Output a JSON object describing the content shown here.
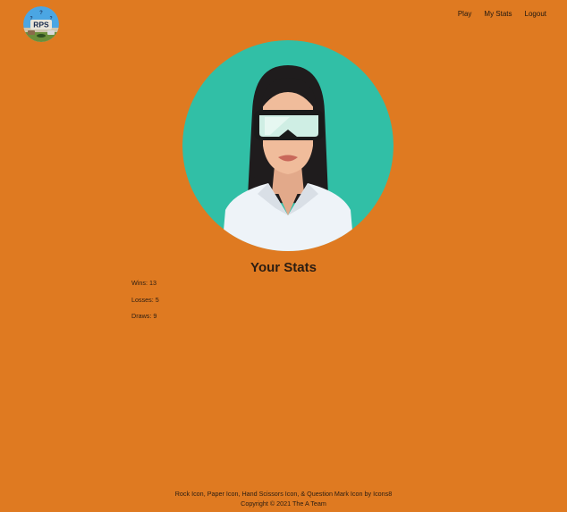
{
  "logo": {
    "text": "RPS"
  },
  "nav": {
    "play": "Play",
    "my_stats": "My Stats",
    "logout": "Logout"
  },
  "main": {
    "title": "Your Stats",
    "wins": "Wins: 13",
    "losses": "Losses: 5",
    "draws": "Draws: 9"
  },
  "footer": {
    "link_rock": "Rock Icon",
    "sep1": ", ",
    "link_paper": "Paper Icon",
    "sep2": ", ",
    "link_scissors": "Hand Scissors Icon",
    "sep3": ", & ",
    "link_question": "Question Mark Icon",
    "by": " by ",
    "link_icons8": "Icons8",
    "copyright": "Copyright © 2021 The A Team"
  },
  "colors": {
    "background": "#df7a21",
    "avatar_bg": "#31bfa6"
  }
}
